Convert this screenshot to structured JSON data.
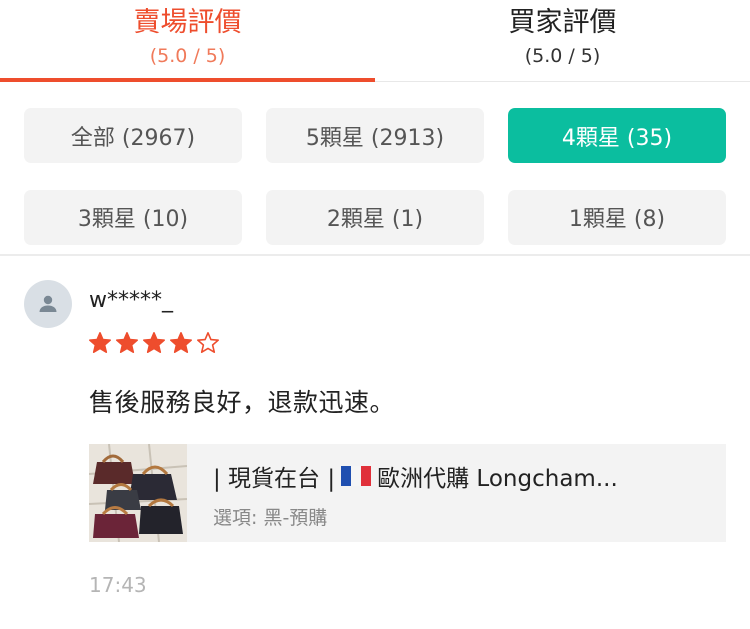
{
  "tabs": [
    {
      "title": "賣場評價",
      "score": "(5.0 / 5)",
      "active": true
    },
    {
      "title": "買家評價",
      "score": "(5.0 / 5)",
      "active": false
    }
  ],
  "filters": [
    {
      "label": "全部 (2967)",
      "selected": false
    },
    {
      "label": "5顆星 (2913)",
      "selected": false
    },
    {
      "label": "4顆星 (35)",
      "selected": true
    },
    {
      "label": "3顆星 (10)",
      "selected": false
    },
    {
      "label": "2顆星 (1)",
      "selected": false
    },
    {
      "label": "1顆星 (8)",
      "selected": false
    }
  ],
  "review": {
    "username": "w*****_",
    "rating": 4,
    "max_rating": 5,
    "comment": "售後服務良好，退款迅速。",
    "product": {
      "title_prefix": "| 現貨在台 |",
      "title_suffix": "歐洲代購 Longcham...",
      "option": "選項: 黑-預購"
    },
    "time": "17:43"
  },
  "colors": {
    "accent": "#ee4d2d",
    "selected_chip": "#0bbe9f",
    "star": "#ee4d2d"
  },
  "icons": {
    "avatar": "user-silhouette-icon",
    "flag": "france-flag-icon",
    "star_filled": "star-filled-icon",
    "star_empty": "star-outline-icon"
  }
}
